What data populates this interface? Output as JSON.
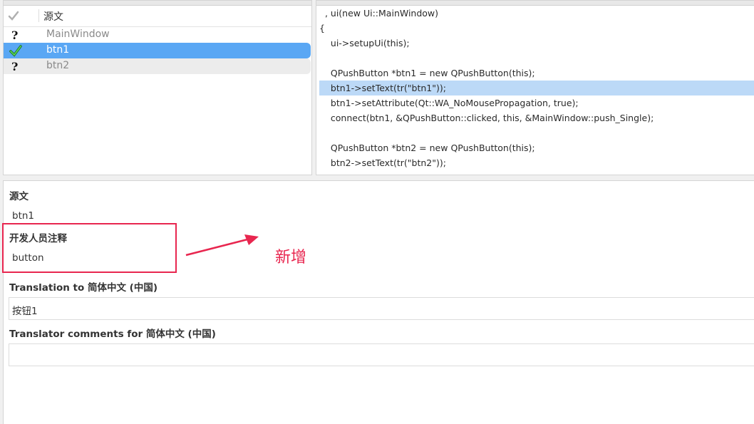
{
  "strings_panel": {
    "header_source": "源文",
    "rows": [
      {
        "label": "MainWindow",
        "status": "unknown"
      },
      {
        "label": "btn1",
        "status": "done"
      },
      {
        "label": "btn2",
        "status": "unknown"
      }
    ]
  },
  "code_panel": {
    "lines": [
      "  , ui(new Ui::MainWindow)",
      "{",
      "    ui->setupUi(this);",
      "",
      "    QPushButton *btn1 = new QPushButton(this);",
      "    btn1->setText(tr(\"btn1\"));",
      "    btn1->setAttribute(Qt::WA_NoMousePropagation, true);",
      "    connect(btn1, &QPushButton::clicked, this, &MainWindow::push_Single);",
      "",
      "    QPushButton *btn2 = new QPushButton(this);",
      "    btn2->setText(tr(\"btn2\"));"
    ],
    "highlight_index": 5
  },
  "editor": {
    "source_title": "源文",
    "source_value": "btn1",
    "dev_comment_title": "开发人员注释",
    "dev_comment_value": "button",
    "translation_title": "Translation to 简体中文 (中国)",
    "translation_value": "按钮1",
    "translator_comments_title": "Translator comments for 简体中文 (中国)",
    "translator_comments_value": ""
  },
  "annotation": {
    "label": "新增",
    "color": "#e8264f"
  },
  "colors": {
    "selection": "#5aa7f4",
    "code_highlight": "#bcd9f7",
    "done_check": "#2fa82f"
  }
}
